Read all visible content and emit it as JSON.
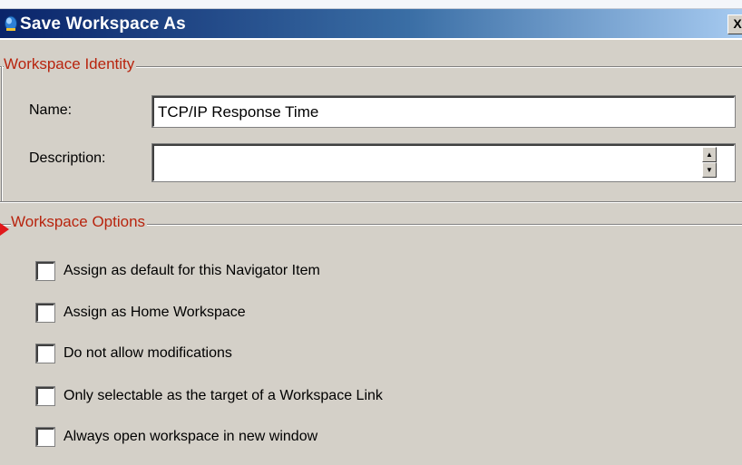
{
  "window": {
    "title": "Save Workspace As",
    "close_glyph": "X"
  },
  "identity": {
    "legend": "Workspace Identity",
    "name_label": "Name:",
    "name_value": "TCP/IP Response Time",
    "description_label": "Description:",
    "description_value": ""
  },
  "options": {
    "legend": "Workspace Options",
    "items": [
      {
        "label": "Assign as default for this Navigator Item",
        "checked": false
      },
      {
        "label": "Assign as Home Workspace",
        "checked": false
      },
      {
        "label": "Do not allow modifications",
        "checked": false
      },
      {
        "label": "Only selectable as the target of a Workspace Link",
        "checked": false
      },
      {
        "label": "Always open workspace in new window",
        "checked": false
      }
    ]
  },
  "icons": {
    "app": "workspace-app-icon",
    "close": "close-icon",
    "spin_up": "spin-up-icon",
    "spin_down": "spin-down-icon",
    "annotation": "red-pointer-arrow-icon"
  },
  "colors": {
    "titlebar_start": "#0a246a",
    "titlebar_end": "#a6caf0",
    "legend_text": "#b8240e",
    "dialog_bg": "#d4d0c8",
    "annotation_arrow": "#e0181b"
  }
}
